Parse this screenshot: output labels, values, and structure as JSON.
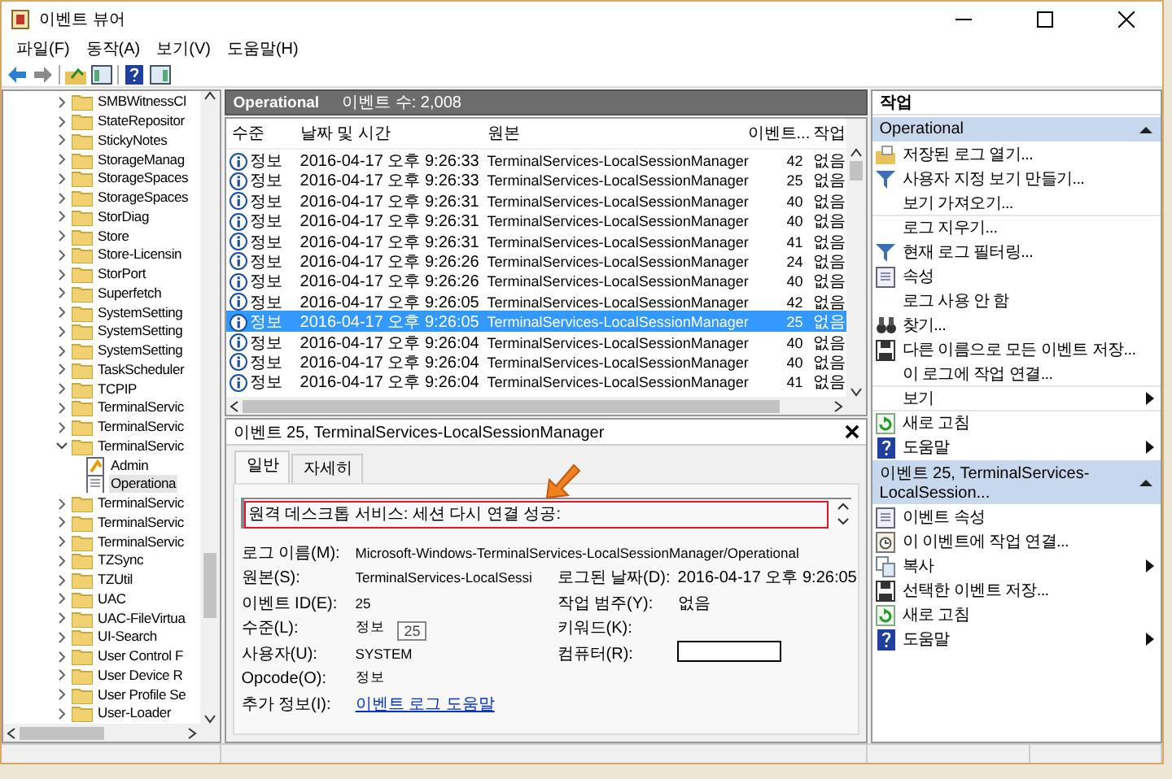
{
  "window": {
    "title": "이벤트 뷰어"
  },
  "menu": [
    "파일(F)",
    "동작(A)",
    "보기(V)",
    "도움말(H)"
  ],
  "tree": [
    {
      "label": "SMBWitnessCl",
      "kind": "folder",
      "expanded": false,
      "selected": false
    },
    {
      "label": "StateRepositor",
      "kind": "folder",
      "expanded": false,
      "selected": false
    },
    {
      "label": "StickyNotes",
      "kind": "folder",
      "expanded": false,
      "selected": false
    },
    {
      "label": "StorageManag",
      "kind": "folder",
      "expanded": false,
      "selected": false
    },
    {
      "label": "StorageSpaces",
      "kind": "folder",
      "expanded": false,
      "selected": false
    },
    {
      "label": "StorageSpaces",
      "kind": "folder",
      "expanded": false,
      "selected": false
    },
    {
      "label": "StorDiag",
      "kind": "folder",
      "expanded": false,
      "selected": false
    },
    {
      "label": "Store",
      "kind": "folder",
      "expanded": false,
      "selected": false
    },
    {
      "label": "Store-Licensin",
      "kind": "folder",
      "expanded": false,
      "selected": false
    },
    {
      "label": "StorPort",
      "kind": "folder",
      "expanded": false,
      "selected": false
    },
    {
      "label": "Superfetch",
      "kind": "folder",
      "expanded": false,
      "selected": false
    },
    {
      "label": "SystemSetting",
      "kind": "folder",
      "expanded": false,
      "selected": false
    },
    {
      "label": "SystemSetting",
      "kind": "folder",
      "expanded": false,
      "selected": false
    },
    {
      "label": "SystemSetting",
      "kind": "folder",
      "expanded": false,
      "selected": false
    },
    {
      "label": "TaskScheduler",
      "kind": "folder",
      "expanded": false,
      "selected": false
    },
    {
      "label": "TCPIP",
      "kind": "folder",
      "expanded": false,
      "selected": false
    },
    {
      "label": "TerminalServic",
      "kind": "folder",
      "expanded": false,
      "selected": false
    },
    {
      "label": "TerminalServic",
      "kind": "folder",
      "expanded": false,
      "selected": false
    },
    {
      "label": "TerminalServic",
      "kind": "folder",
      "expanded": true,
      "selected": false,
      "children": [
        {
          "label": "Admin",
          "kind": "adminlog",
          "selected": false
        },
        {
          "label": "Operationa",
          "kind": "log",
          "selected": true
        }
      ]
    },
    {
      "label": "TerminalServic",
      "kind": "folder",
      "expanded": false,
      "selected": false
    },
    {
      "label": "TerminalServic",
      "kind": "folder",
      "expanded": false,
      "selected": false
    },
    {
      "label": "TerminalServic",
      "kind": "folder",
      "expanded": false,
      "selected": false
    },
    {
      "label": "TZSync",
      "kind": "folder",
      "expanded": false,
      "selected": false
    },
    {
      "label": "TZUtil",
      "kind": "folder",
      "expanded": false,
      "selected": false
    },
    {
      "label": "UAC",
      "kind": "folder",
      "expanded": false,
      "selected": false
    },
    {
      "label": "UAC-FileVirtua",
      "kind": "folder",
      "expanded": false,
      "selected": false
    },
    {
      "label": "UI-Search",
      "kind": "folder",
      "expanded": false,
      "selected": false
    },
    {
      "label": "User Control F",
      "kind": "folder",
      "expanded": false,
      "selected": false
    },
    {
      "label": "User Device R",
      "kind": "folder",
      "expanded": false,
      "selected": false
    },
    {
      "label": "User Profile Se",
      "kind": "folder",
      "expanded": false,
      "selected": false
    },
    {
      "label": "User-Loader",
      "kind": "folder",
      "expanded": false,
      "selected": false
    }
  ],
  "log_header": {
    "name": "Operational",
    "count": "이벤트 수: 2,008"
  },
  "table": {
    "columns": [
      "수준",
      "날짜 및 시간",
      "원본",
      "이벤트...",
      "작업"
    ],
    "rows": [
      {
        "cells": [
          "정보",
          "2016-04-17 오후 9:26:33",
          "TerminalServices-LocalSessionManager",
          "42",
          "없음"
        ],
        "selected": false
      },
      {
        "cells": [
          "정보",
          "2016-04-17 오후 9:26:33",
          "TerminalServices-LocalSessionManager",
          "25",
          "없음"
        ],
        "selected": false
      },
      {
        "cells": [
          "정보",
          "2016-04-17 오후 9:26:31",
          "TerminalServices-LocalSessionManager",
          "40",
          "없음"
        ],
        "selected": false
      },
      {
        "cells": [
          "정보",
          "2016-04-17 오후 9:26:31",
          "TerminalServices-LocalSessionManager",
          "40",
          "없음"
        ],
        "selected": false
      },
      {
        "cells": [
          "정보",
          "2016-04-17 오후 9:26:31",
          "TerminalServices-LocalSessionManager",
          "41",
          "없음"
        ],
        "selected": false
      },
      {
        "cells": [
          "정보",
          "2016-04-17 오후 9:26:26",
          "TerminalServices-LocalSessionManager",
          "24",
          "없음"
        ],
        "selected": false
      },
      {
        "cells": [
          "정보",
          "2016-04-17 오후 9:26:26",
          "TerminalServices-LocalSessionManager",
          "40",
          "없음"
        ],
        "selected": false
      },
      {
        "cells": [
          "정보",
          "2016-04-17 오후 9:26:05",
          "TerminalServices-LocalSessionManager",
          "42",
          "없음"
        ],
        "selected": false
      },
      {
        "cells": [
          "정보",
          "2016-04-17 오후 9:26:05",
          "TerminalServices-LocalSessionManager",
          "25",
          "없음"
        ],
        "selected": true
      },
      {
        "cells": [
          "정보",
          "2016-04-17 오후 9:26:04",
          "TerminalServices-LocalSessionManager",
          "40",
          "없음"
        ],
        "selected": false
      },
      {
        "cells": [
          "정보",
          "2016-04-17 오후 9:26:04",
          "TerminalServices-LocalSessionManager",
          "40",
          "없음"
        ],
        "selected": false
      },
      {
        "cells": [
          "정보",
          "2016-04-17 오후 9:26:04",
          "TerminalServices-LocalSessionManager",
          "41",
          "없음"
        ],
        "selected": false
      }
    ]
  },
  "details": {
    "title": "이벤트 25, TerminalServices-LocalSessionManager",
    "tabs": [
      {
        "label": "일반",
        "selected": true
      },
      {
        "label": "자세히",
        "selected": false
      }
    ],
    "message": {
      "text": "원격 데스크톱 서비스: 세션 다시 연결 성공:",
      "highlighted": true
    },
    "rows": [
      [
        {
          "label": "로그 이름(M):",
          "value": "Microsoft-Windows-TerminalServices-LocalSessionManager/Operational",
          "kind": "text"
        }
      ],
      [
        {
          "label": "원본(S):",
          "value": "TerminalServices-LocalSessi",
          "kind": "text"
        },
        {
          "label": "로그된 날짜(D):",
          "value": "2016-04-17 오후 9:26:05",
          "kind": "text"
        }
      ],
      [
        {
          "label": "이벤트 ID(E):",
          "value": "25",
          "kind": "text"
        },
        {
          "label": "작업 범주(Y):",
          "value": "없음",
          "kind": "text"
        }
      ],
      [
        {
          "label": "수준(L):",
          "value": "정보",
          "kind": "text"
        },
        {
          "label": "키워드(K):",
          "kind": "none"
        }
      ],
      [
        {
          "label": "사용자(U):",
          "value": "SYSTEM",
          "kind": "text"
        },
        {
          "label": "컴퓨터(R):",
          "kind": "box"
        }
      ],
      [
        {
          "label": "Opcode(O):",
          "value": "정보",
          "kind": "text"
        }
      ],
      [
        {
          "label": "추가 정보(I):",
          "value": "이벤트 로그 도움말",
          "kind": "link"
        }
      ]
    ],
    "tooltip": "25"
  },
  "actions": {
    "title": "작업",
    "sections": [
      {
        "title": "Operational",
        "expanded": true,
        "items": [
          {
            "label": "저장된 로그 열기...",
            "submenu": false,
            "separator": false
          },
          {
            "label": "사용자 지정 보기 만들기...",
            "submenu": false,
            "separator": false
          },
          {
            "label": "보기 가져오기...",
            "submenu": false,
            "separator": false
          },
          {
            "label": "로그 지우기...",
            "submenu": false,
            "separator": true
          },
          {
            "label": "현재 로그 필터링...",
            "submenu": false,
            "separator": false
          },
          {
            "label": "속성",
            "submenu": false,
            "separator": false
          },
          {
            "label": "로그 사용 안 함",
            "submenu": false,
            "separator": false
          },
          {
            "label": "찾기...",
            "submenu": false,
            "separator": false
          },
          {
            "label": "다른 이름으로 모든 이벤트 저장...",
            "submenu": false,
            "separator": false
          },
          {
            "label": "이 로그에 작업 연결...",
            "submenu": false,
            "separator": false
          },
          {
            "label": "보기",
            "submenu": true,
            "separator": true
          },
          {
            "label": "새로 고침",
            "submenu": false,
            "separator": true
          },
          {
            "label": "도움말",
            "submenu": true,
            "separator": false
          }
        ]
      },
      {
        "title": "이벤트 25, TerminalServices-LocalSession...",
        "expanded": true,
        "items": [
          {
            "label": "이벤트 속성",
            "submenu": false,
            "separator": false
          },
          {
            "label": "이 이벤트에 작업 연결...",
            "submenu": false,
            "separator": false
          },
          {
            "label": "복사",
            "submenu": true,
            "separator": false
          },
          {
            "label": "선택한 이벤트 저장...",
            "submenu": false,
            "separator": false
          },
          {
            "label": "새로 고침",
            "submenu": false,
            "separator": false
          },
          {
            "label": "도움말",
            "submenu": true,
            "separator": false
          }
        ]
      }
    ]
  }
}
